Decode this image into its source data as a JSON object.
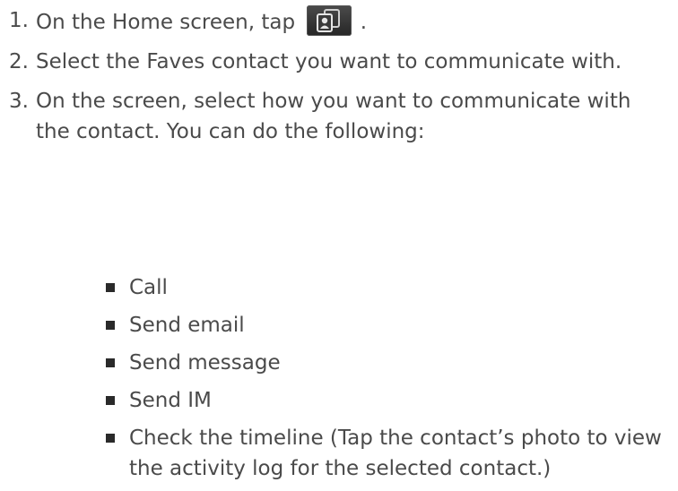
{
  "steps": [
    {
      "num": "1.",
      "before_icon": "On the Home screen, tap",
      "icon": "people-contacts-icon",
      "after_icon": "."
    },
    {
      "num": "2.",
      "text": "Select the Faves contact you want to communicate with."
    },
    {
      "num": "3.",
      "text": "On the screen, select how you want to communicate with the contact. You can do the following:"
    }
  ],
  "options": [
    "Call",
    "Send email",
    "Send message",
    "Send IM",
    "Check the timeline (Tap the contact’s photo to view the activity log for the selected contact.)"
  ],
  "colors": {
    "text": "#4a4a4a",
    "icon_bg": "#333333",
    "icon_accent": "#d8d8d8"
  }
}
